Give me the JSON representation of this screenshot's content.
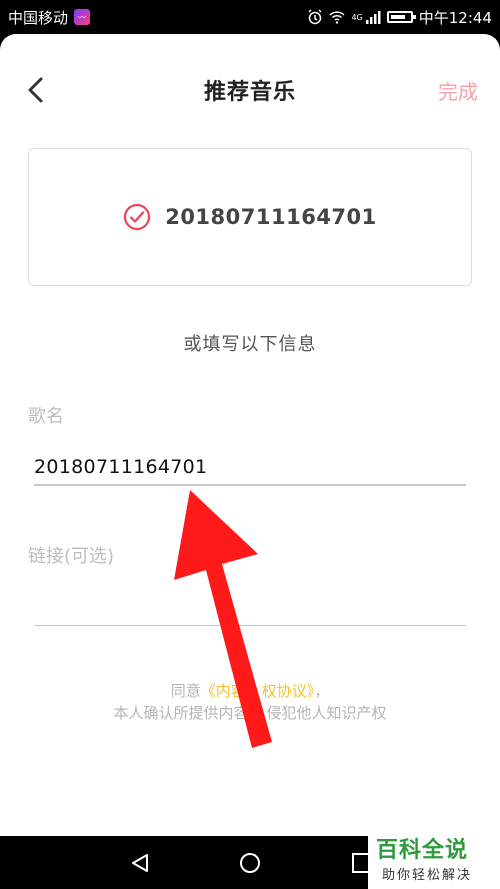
{
  "statusbar": {
    "carrier": "中国移动",
    "network": "4G",
    "time": "中午12:44"
  },
  "header": {
    "title": "推荐音乐",
    "done_label": "完成",
    "back_icon": "chevron-left-icon"
  },
  "selected": {
    "text": "20180711164701",
    "icon": "check-circle-icon",
    "accent": "#e8455d"
  },
  "form": {
    "or_label": "或填写以下信息",
    "song_name_label": "歌名",
    "song_name_value": "20180711164701",
    "link_label": "链接(可选)",
    "link_value": ""
  },
  "agreement": {
    "prefix": "同意",
    "link_text": "《内容",
    "link_text_tail": "权协议》",
    "suffix": "，",
    "line2a": "本人确认所提供内容",
    "line2b": "侵犯他人知识产权"
  },
  "watermark": {
    "title": "百科全说",
    "subtitle": "助你轻松解决"
  },
  "colors": {
    "done": "#f4a1ad",
    "agreement_link": "#f2c232",
    "arrow": "#ff1a1a"
  }
}
